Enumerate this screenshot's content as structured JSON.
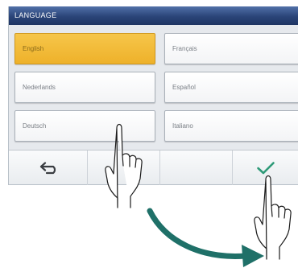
{
  "window": {
    "title": "LANGUAGE"
  },
  "languages": [
    {
      "label": "English",
      "selected": true
    },
    {
      "label": "Français",
      "selected": false
    },
    {
      "label": "Nederlands",
      "selected": false
    },
    {
      "label": "Español",
      "selected": false
    },
    {
      "label": "Deutsch",
      "selected": false
    },
    {
      "label": "Italiano",
      "selected": false
    }
  ],
  "toolbar": {
    "back_icon": "back-arrow-icon",
    "confirm_icon": "checkmark-icon"
  },
  "colors": {
    "titlebar": "#2a4478",
    "selected": "#eeb12a",
    "checkmark": "#2e9a78",
    "arrow": "#1f7068"
  }
}
